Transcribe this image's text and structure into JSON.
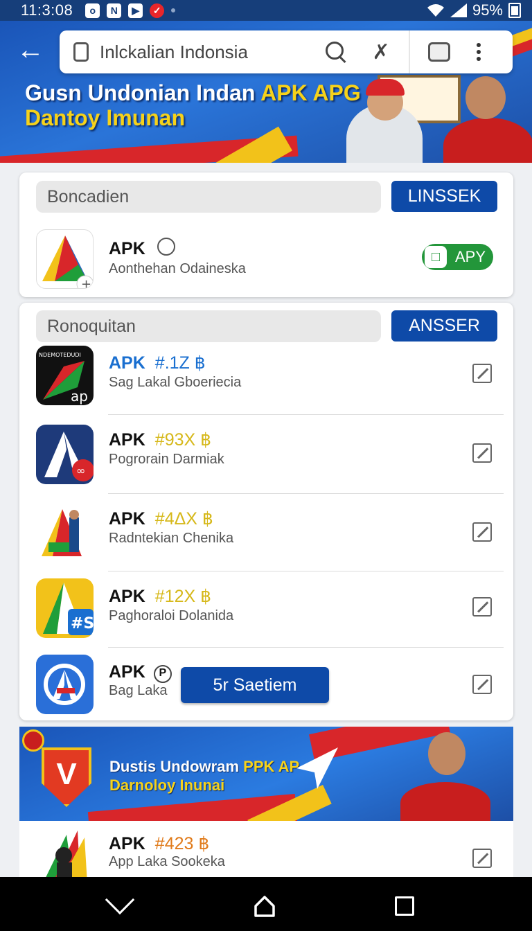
{
  "status_bar": {
    "time": "11:3:08",
    "battery": "95%"
  },
  "browser": {
    "query": "Inlckalian Indonsia"
  },
  "header_banner": {
    "title_line1": "Gusn Undonian Indan ",
    "title_highlight": "APK APG",
    "title_line2": "Dantoy Imunan"
  },
  "section1": {
    "heading": "Boncadien",
    "button": "LINSSEK",
    "app": {
      "name": "APK",
      "subtitle": "Aonthehan Odaineska",
      "action": "APY",
      "action_icon": "chat-bubble-icon"
    }
  },
  "section2": {
    "heading": "Ronoquitan",
    "button": "ANSSER",
    "icon1_text": "NDEMOTEDUDI",
    "icon1_sub": "ap",
    "icon4_badge": "#S",
    "apps": [
      {
        "name": "APK",
        "tag": "#.1Z ฿",
        "tag_color": "#1a6fd0",
        "subtitle": "Sag Lakal Gboeriecia"
      },
      {
        "name": "APK",
        "tag": "#93X ฿",
        "tag_color": "#d6b81a",
        "subtitle": "Pogrorain Darmiak"
      },
      {
        "name": "APK",
        "tag": "#4ΔX ฿",
        "tag_color": "#d6b81a",
        "subtitle": "Radntekian Chenika"
      },
      {
        "name": "APK",
        "tag": "#12X ฿",
        "tag_color": "#d6b81a",
        "subtitle": "Paghoraloi Dolanida"
      },
      {
        "name": "APK",
        "tag": "P",
        "tag_color": "#333333",
        "subtitle": "Bag Laka",
        "action": "5r Saetiem"
      }
    ]
  },
  "ad_banner": {
    "title_line1": "Dustis Undowram ",
    "title_highlight": "PPK AP",
    "title_line2": "Darnoloy Inunai",
    "shield_letter": "V"
  },
  "bottom_app": {
    "name": "APK",
    "tag": "#423 ฿",
    "tag_color": "#e07a1a",
    "subtitle": "App Laka Sookeka"
  },
  "colors": {
    "primary_blue": "#0e4aa8",
    "header_blue": "#1a55b8",
    "accent_red": "#d8262a",
    "accent_yellow": "#f6d21a",
    "action_green": "#23963a"
  }
}
